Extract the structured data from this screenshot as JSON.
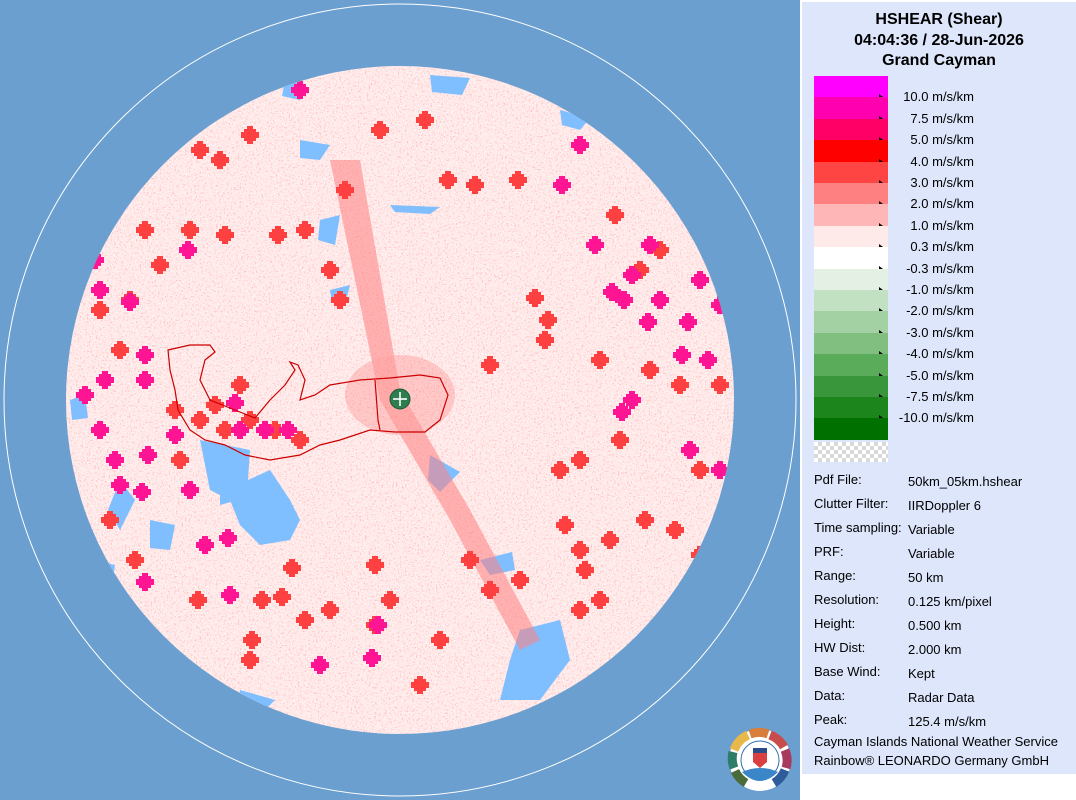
{
  "header": {
    "product": "HSHEAR (Shear)",
    "datetime": "04:04:36 / 28-Jun-2026",
    "site": "Grand Cayman"
  },
  "legend": [
    {
      "label": "10.0 m/s/km",
      "color": "#ff00ff"
    },
    {
      "label": "7.5 m/s/km",
      "color": "#ff00b0"
    },
    {
      "label": "5.0 m/s/km",
      "color": "#ff0066"
    },
    {
      "label": "4.0 m/s/km",
      "color": "#ff0000"
    },
    {
      "label": "3.0 m/s/km",
      "color": "#ff4444"
    },
    {
      "label": "2.0 m/s/km",
      "color": "#ff8080"
    },
    {
      "label": "1.0 m/s/km",
      "color": "#ffb6b6"
    },
    {
      "label": "0.3 m/s/km",
      "color": "#ffeaea"
    },
    {
      "label": "-0.3 m/s/km",
      "color": "#ffffff"
    },
    {
      "label": "-1.0 m/s/km",
      "color": "#e3f0e3"
    },
    {
      "label": "-2.0 m/s/km",
      "color": "#c2e0c2"
    },
    {
      "label": "-3.0 m/s/km",
      "color": "#a3d1a3"
    },
    {
      "label": "-4.0 m/s/km",
      "color": "#80bf80"
    },
    {
      "label": "-5.0 m/s/km",
      "color": "#5aab5a"
    },
    {
      "label": "-7.5 m/s/km",
      "color": "#3a963a"
    },
    {
      "label": "-10.0 m/s/km",
      "color": "#1c851c"
    },
    {
      "label": "",
      "color": "#007000"
    }
  ],
  "info": [
    {
      "key": "Pdf File:",
      "value": "50km_05km.hshear"
    },
    {
      "key": "Clutter Filter:",
      "value": "IIRDoppler 6"
    },
    {
      "key": "Time sampling:",
      "value": "Variable"
    },
    {
      "key": "PRF:",
      "value": "Variable"
    },
    {
      "key": "Range:",
      "value": "50 km"
    },
    {
      "key": "Resolution:",
      "value": "0.125 km/pixel"
    },
    {
      "key": "Height:",
      "value": "0.500 km"
    },
    {
      "key": "HW Dist:",
      "value": "2.000 km"
    },
    {
      "key": "Base Wind:",
      "value": "Kept"
    },
    {
      "key": "Data:",
      "value": "Radar Data"
    },
    {
      "key": "Peak:",
      "value": "125.4 m/s/km"
    }
  ],
  "credits": {
    "agency": "Cayman Islands National Weather Service",
    "vendor": "Rainbow® LEONARDO Germany GmbH"
  },
  "colors": {
    "background": "#6a9fcf",
    "panel": "#dde6fa",
    "no_echo_blue": "#80bfff",
    "coastline": "#cc0000",
    "radar_site": "#2e7d4f"
  },
  "icons": {
    "radar_site": "radar-site-icon",
    "logo": "cayman-nws-logo-icon"
  }
}
